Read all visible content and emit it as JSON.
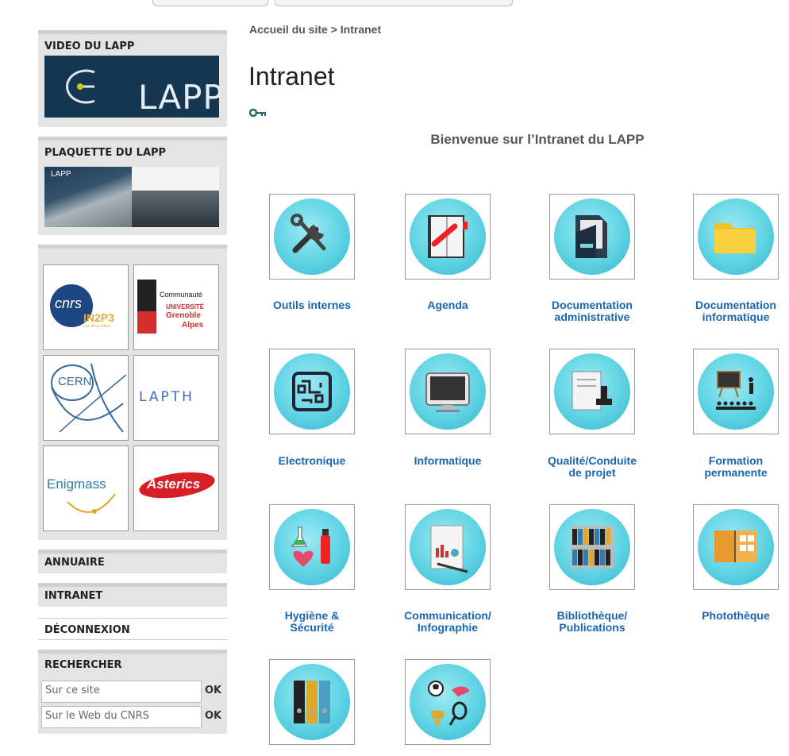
{
  "breadcrumb": "Accueil du site > Intranet",
  "page_title": "Intranet",
  "welcome": "Bienvenue sur l’Intranet du LAPP",
  "sidebar": {
    "video_title": "VIDEO DU LAPP",
    "video_logo_text": "LAPP",
    "plaquette_title": "PLAQUETTE DU LAPP",
    "plaquette_logo_text": "LAPP",
    "partners": {
      "cnrs": "cnrs",
      "in2p3": "IN2P3",
      "in2p3_sub": "Les deux infinis",
      "uga_line1": "Communauté",
      "uga_line2": "UNIVERSITÉ",
      "uga_line3": "Grenoble",
      "uga_line4": "Alpes",
      "cern": "CERN",
      "lapth": "LAPTH",
      "enigmass": "Enigmass",
      "asterics": "Asterics"
    },
    "menu": {
      "annuaire": "ANNUAIRE",
      "intranet": "INTRANET",
      "deconnexion": "DÉCONNEXION"
    },
    "search": {
      "title": "RECHERCHER",
      "site_placeholder": "Sur ce site",
      "cnrs_placeholder": "Sur le Web du CNRS",
      "ok": "OK"
    }
  },
  "tiles": [
    {
      "line1": "Outils internes",
      "line2": "",
      "icon": "tools-icon"
    },
    {
      "line1": "Agenda",
      "line2": "",
      "icon": "agenda-icon"
    },
    {
      "line1": "Documentation",
      "line2": "administrative",
      "icon": "document-folder-icon"
    },
    {
      "line1": "Documentation",
      "line2": "informatique",
      "icon": "folder-icon"
    },
    {
      "line1": "Electronique",
      "line2": "",
      "icon": "circuit-icon"
    },
    {
      "line1": "Informatique",
      "line2": "",
      "icon": "monitor-icon"
    },
    {
      "line1": "Qualité/Conduite",
      "line2": "de projet",
      "icon": "stamp-icon"
    },
    {
      "line1": "Formation",
      "line2": "permanente",
      "icon": "classroom-icon"
    },
    {
      "line1": "Hygiène &",
      "line2": "Sécurité",
      "icon": "safety-icon"
    },
    {
      "line1": "Communication/",
      "line2": "Infographie",
      "icon": "report-chart-icon"
    },
    {
      "line1": "Bibliothèque/",
      "line2": "Publications",
      "icon": "bookshelf-icon"
    },
    {
      "line1": "Photothèque",
      "line2": "",
      "icon": "photo-album-icon"
    },
    {
      "line1": "",
      "line2": "",
      "icon": "binders-icon"
    },
    {
      "line1": "",
      "line2": "",
      "icon": "sports-icon"
    }
  ]
}
